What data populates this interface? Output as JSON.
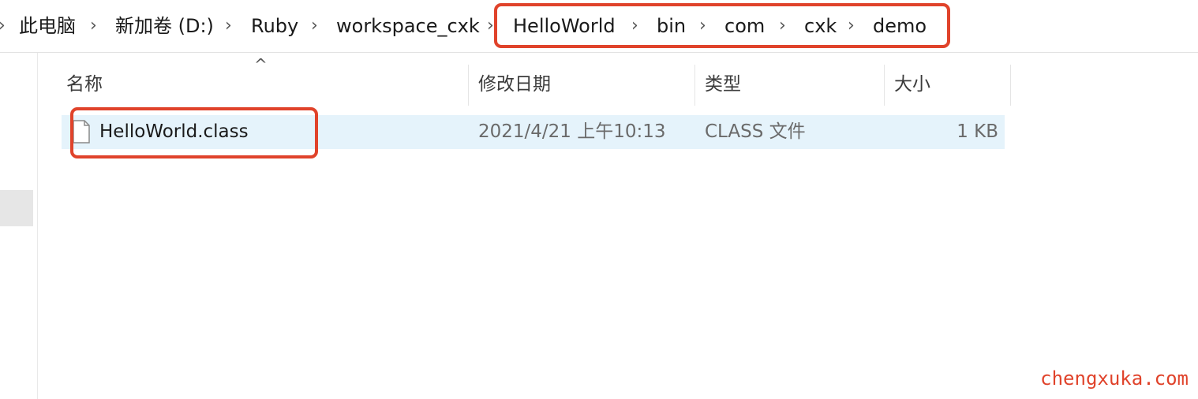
{
  "breadcrumb": {
    "items": [
      "此电脑",
      "新加卷 (D:)",
      "Ruby",
      "workspace_cxk",
      "HelloWorld",
      "bin",
      "com",
      "cxk",
      "demo"
    ],
    "separator": "›"
  },
  "columns": {
    "name": "名称",
    "date": "修改日期",
    "type": "类型",
    "size": "大小",
    "sort_indicator": "^"
  },
  "files": [
    {
      "name": "HelloWorld.class",
      "date": "2021/4/21 上午10:13",
      "type": "CLASS 文件",
      "size": "1 KB",
      "icon": "file-icon"
    }
  ],
  "watermark": "chengxuka.com",
  "colors": {
    "highlight": "#e0432b",
    "selection": "#e5f3fb"
  }
}
